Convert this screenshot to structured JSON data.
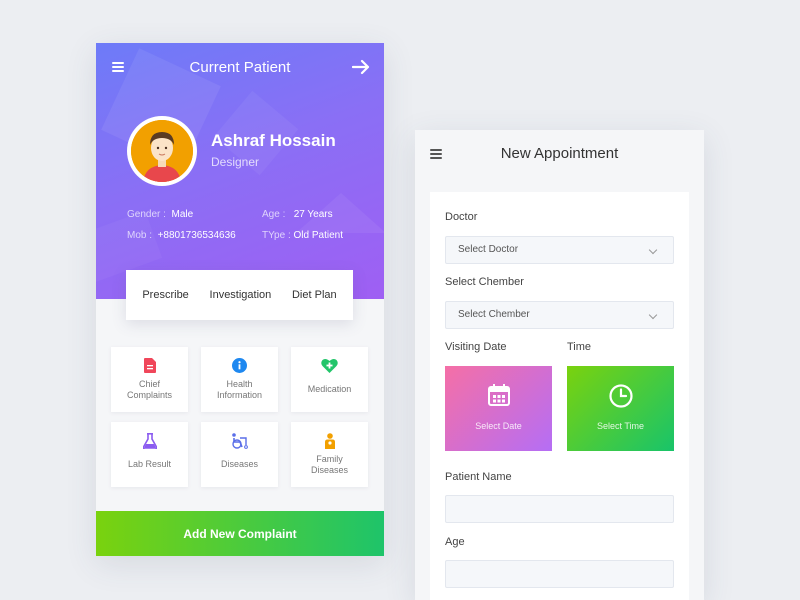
{
  "left_screen": {
    "header": {
      "title": "Current Patient",
      "menu_icon": "menu-icon",
      "forward_icon": "arrow-right-icon"
    },
    "patient": {
      "name": "Ashraf Hossain",
      "role": "Designer",
      "gender_label": "Gender :",
      "gender_value": "Male",
      "age_label": "Age :",
      "age_value": "27 Years",
      "mobile_label": "Mob :",
      "mobile_value": "+8801736534636",
      "type_label": "TYpe :",
      "type_value": "Old Patient"
    },
    "tabs": [
      "Prescribe",
      "Investigation",
      "Diet Plan"
    ],
    "tiles": [
      {
        "line1": "Chief",
        "line2": "Complaints",
        "icon": "document-icon",
        "color": "#f0465a"
      },
      {
        "line1": "Health",
        "line2": "Information",
        "icon": "info-icon",
        "color": "#1e88f0"
      },
      {
        "line1": "Medication",
        "line2": "",
        "icon": "heart-plus-icon",
        "color": "#22c56a"
      },
      {
        "line1": "Lab Result",
        "line2": "",
        "icon": "flask-icon",
        "color": "#8b5cf0"
      },
      {
        "line1": "Diseases",
        "line2": "",
        "icon": "wheelchair-icon",
        "color": "#5a6ee8"
      },
      {
        "line1": "Family",
        "line2": "Diseases",
        "icon": "family-icon",
        "color": "#f2a000"
      }
    ],
    "add_button": "Add New Complaint"
  },
  "right_screen": {
    "header": {
      "title": "New Appointment",
      "menu_icon": "menu-icon"
    },
    "doctor_label": "Doctor",
    "doctor_select": "Select Doctor",
    "chember_label": "Select Chember",
    "chember_select": "Select Chember",
    "visiting_date_label": "Visiting Date",
    "time_label": "Time",
    "select_date": "Select Date",
    "select_time": "Select Time",
    "patient_name_label": "Patient Name",
    "age_label": "Age"
  },
  "colors": {
    "hero_gradient_start": "#6d7bf8",
    "hero_gradient_end": "#9f5ff3",
    "green_start": "#7ad20e",
    "green_end": "#1ec46a",
    "pink_start": "#f56fa6",
    "purple_end": "#b56ef5"
  }
}
